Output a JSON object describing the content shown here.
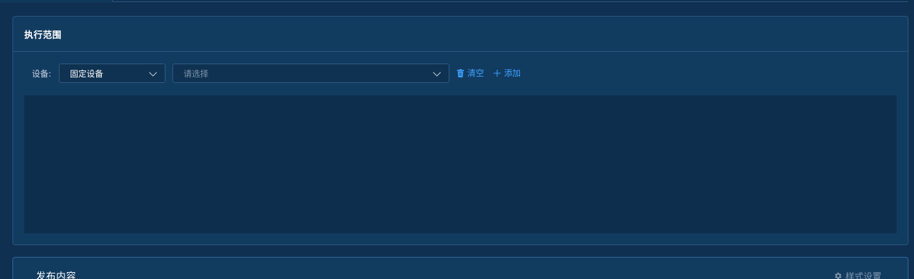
{
  "scope": {
    "title": "执行范围",
    "device_label": "设备:",
    "device_type_value": "固定设备",
    "device_select_placeholder": "请选择",
    "clear_label": "清空",
    "add_label": "添加"
  },
  "publish": {
    "title": "发布内容",
    "style_settings_label": "样式设置"
  },
  "colors": {
    "background": "#0f3050",
    "card": "#123b60",
    "accent": "#3fa3ff",
    "device_area": "#0d2f4d"
  },
  "icons": {
    "clear": "trash-icon",
    "add": "plus-icon",
    "style_settings": "gear-icon",
    "dropdown": "chevron-down-icon"
  }
}
